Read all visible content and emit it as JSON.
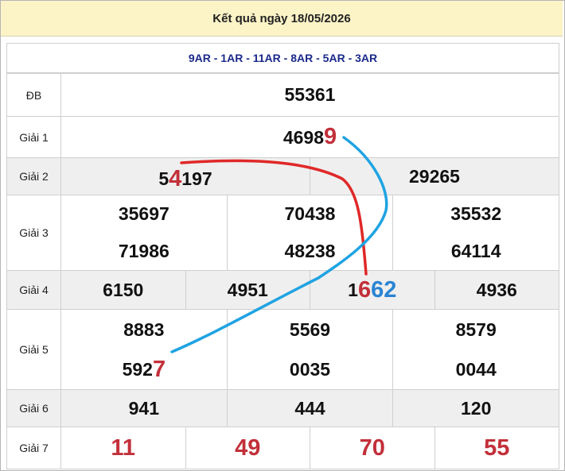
{
  "header": {
    "title": "Kết quả ngày 18/05/2026"
  },
  "codes": "9AR - 1AR - 11AR - 8AR - 5AR - 3AR",
  "prizes": {
    "db": {
      "label": "ĐB",
      "value": "55361"
    },
    "g1": {
      "label": "Giải 1",
      "value_plain": "4698",
      "value_highlight": "9"
    },
    "g2": {
      "label": "Giải 2",
      "v1_a": "5",
      "v1_b": "4",
      "v1_c": "197",
      "v2": "29265"
    },
    "g3": {
      "label": "Giải 3",
      "values": [
        "35697",
        "70438",
        "35532",
        "71986",
        "48238",
        "64114"
      ]
    },
    "g4": {
      "label": "Giải 4",
      "v1": "6150",
      "v2": "4951",
      "v3_a": "1",
      "v3_b": "6",
      "v3_c": "62",
      "v4": "4936"
    },
    "g5": {
      "label": "Giải 5",
      "values": [
        "8883",
        "5569",
        "8579",
        "0035",
        "0044"
      ],
      "v4_plain": "592",
      "v4_highlight": "7"
    },
    "g6": {
      "label": "Giải 6",
      "values": [
        "941",
        "444",
        "120"
      ]
    },
    "g7": {
      "label": "Giải 7",
      "values": [
        "11",
        "49",
        "70",
        "55"
      ]
    }
  },
  "colors": {
    "red": "#c2303a",
    "blue": "#2a84d2",
    "header_bg": "#fcf3c7",
    "codes_text": "#1b2a8a"
  }
}
